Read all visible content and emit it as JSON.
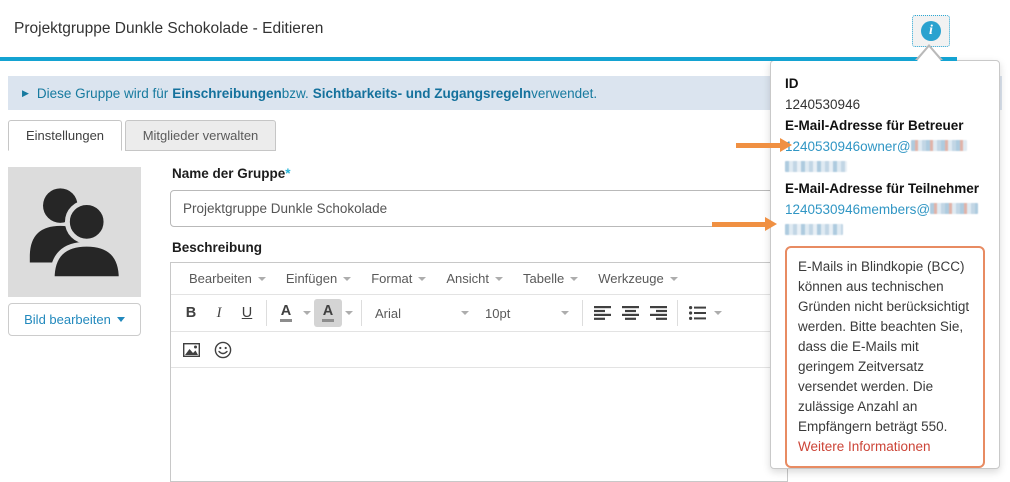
{
  "header": {
    "title": "Projektgruppe Dunkle Schokolade - Editieren",
    "info_icon_glyph": "i"
  },
  "banner": {
    "prefix": "Diese Gruppe wird für",
    "link1": "Einschreibungen",
    "middle": "bzw.",
    "link2": "Sichtbarkeits- und Zugangsregeln",
    "suffix": "verwendet."
  },
  "tabs": [
    {
      "label": "Einstellungen",
      "active": true
    },
    {
      "label": "Mitglieder verwalten",
      "active": false
    }
  ],
  "form": {
    "image_button_label": "Bild bearbeiten",
    "name_label": "Name der Gruppe",
    "required_mark": "*",
    "name_value": "Projektgruppe Dunkle Schokolade",
    "description_label": "Beschreibung"
  },
  "editor": {
    "menus": [
      "Bearbeiten",
      "Einfügen",
      "Format",
      "Ansicht",
      "Tabelle",
      "Werkzeuge"
    ],
    "bold_label": "B",
    "italic_label": "I",
    "underline_label": "U",
    "text_color_label": "A",
    "bg_color_label": "A",
    "font_family_value": "Arial",
    "font_size_value": "10pt"
  },
  "popover": {
    "id_label": "ID",
    "id_value": "1240530946",
    "owner_label": "E-Mail-Adresse für Betreuer",
    "owner_email_visible": "1240530946owner@",
    "members_label": "E-Mail-Adresse für Teilnehmer",
    "members_email_visible": "1240530946members@",
    "notice_text": "E-Mails in Blindkopie (BCC) können aus technischen Gründen nicht berücksichtigt werden. Bitte beachten Sie, dass die E-Mails mit geringem Zeitversatz versendet werden. Die zulässige Anzahl an Empfängern beträgt 550. ",
    "notice_link": "Weitere Informationen"
  },
  "colors": {
    "accent_blue": "#14a3d2",
    "banner_bg": "#dbe4ef",
    "banner_text": "#177a9f",
    "link_blue": "#3096c4",
    "notice_border": "#e88b62",
    "notice_link_red": "#cc4437",
    "arrow_orange": "#f09042"
  }
}
